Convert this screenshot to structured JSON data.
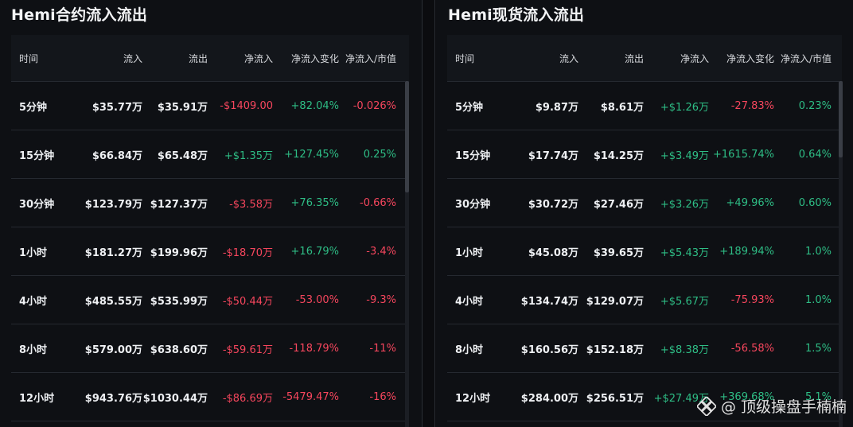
{
  "colors": {
    "positive": "#2ebd85",
    "negative": "#f6465d"
  },
  "left": {
    "title": "Hemi合约流入流出",
    "columns": [
      "时间",
      "流入",
      "流出",
      "净流入",
      "净流入变化",
      "净流入/市值"
    ],
    "rows": [
      {
        "time": "5分钟",
        "inflow": "$35.77万",
        "outflow": "$35.91万",
        "net": "-$1409.00",
        "net_sign": "neg",
        "change": "+82.04%",
        "change_sign": "pos",
        "ratio": "-0.026%",
        "ratio_sign": "neg"
      },
      {
        "time": "15分钟",
        "inflow": "$66.84万",
        "outflow": "$65.48万",
        "net": "+$1.35万",
        "net_sign": "pos",
        "change": "+127.45%",
        "change_sign": "pos",
        "ratio": "0.25%",
        "ratio_sign": "pos"
      },
      {
        "time": "30分钟",
        "inflow": "$123.79万",
        "outflow": "$127.37万",
        "net": "-$3.58万",
        "net_sign": "neg",
        "change": "+76.35%",
        "change_sign": "pos",
        "ratio": "-0.66%",
        "ratio_sign": "neg"
      },
      {
        "time": "1小时",
        "inflow": "$181.27万",
        "outflow": "$199.96万",
        "net": "-$18.70万",
        "net_sign": "neg",
        "change": "+16.79%",
        "change_sign": "pos",
        "ratio": "-3.4%",
        "ratio_sign": "neg"
      },
      {
        "time": "4小时",
        "inflow": "$485.55万",
        "outflow": "$535.99万",
        "net": "-$50.44万",
        "net_sign": "neg",
        "change": "-53.00%",
        "change_sign": "neg",
        "ratio": "-9.3%",
        "ratio_sign": "neg"
      },
      {
        "time": "8小时",
        "inflow": "$579.00万",
        "outflow": "$638.60万",
        "net": "-$59.61万",
        "net_sign": "neg",
        "change": "-118.79%",
        "change_sign": "neg",
        "ratio": "-11%",
        "ratio_sign": "neg"
      },
      {
        "time": "12小时",
        "inflow": "$943.76万",
        "outflow": "$1030.44万",
        "net": "-$86.69万",
        "net_sign": "neg",
        "change": "-5479.47%",
        "change_sign": "neg",
        "ratio": "-16%",
        "ratio_sign": "neg"
      }
    ]
  },
  "right": {
    "title": "Hemi现货流入流出",
    "columns": [
      "时间",
      "流入",
      "流出",
      "净流入",
      "净流入变化",
      "净流入/市值"
    ],
    "rows": [
      {
        "time": "5分钟",
        "inflow": "$9.87万",
        "outflow": "$8.61万",
        "net": "+$1.26万",
        "net_sign": "pos",
        "change": "-27.83%",
        "change_sign": "neg",
        "ratio": "0.23%",
        "ratio_sign": "pos"
      },
      {
        "time": "15分钟",
        "inflow": "$17.74万",
        "outflow": "$14.25万",
        "net": "+$3.49万",
        "net_sign": "pos",
        "change": "+1615.74%",
        "change_sign": "pos",
        "ratio": "0.64%",
        "ratio_sign": "pos"
      },
      {
        "time": "30分钟",
        "inflow": "$30.72万",
        "outflow": "$27.46万",
        "net": "+$3.26万",
        "net_sign": "pos",
        "change": "+49.96%",
        "change_sign": "pos",
        "ratio": "0.60%",
        "ratio_sign": "pos"
      },
      {
        "time": "1小时",
        "inflow": "$45.08万",
        "outflow": "$39.65万",
        "net": "+$5.43万",
        "net_sign": "pos",
        "change": "+189.94%",
        "change_sign": "pos",
        "ratio": "1.0%",
        "ratio_sign": "pos"
      },
      {
        "time": "4小时",
        "inflow": "$134.74万",
        "outflow": "$129.07万",
        "net": "+$5.67万",
        "net_sign": "pos",
        "change": "-75.93%",
        "change_sign": "neg",
        "ratio": "1.0%",
        "ratio_sign": "pos"
      },
      {
        "time": "8小时",
        "inflow": "$160.56万",
        "outflow": "$152.18万",
        "net": "+$8.38万",
        "net_sign": "pos",
        "change": "-56.58%",
        "change_sign": "neg",
        "ratio": "1.5%",
        "ratio_sign": "pos"
      },
      {
        "time": "12小时",
        "inflow": "$284.00万",
        "outflow": "$256.51万",
        "net": "+$27.49万",
        "net_sign": "pos",
        "change": "+369.68%",
        "change_sign": "pos",
        "ratio": "5.1%",
        "ratio_sign": "pos"
      }
    ]
  },
  "watermark": {
    "text": "@ 顶级操盘手楠楠",
    "icon": "platform-logo-icon"
  }
}
